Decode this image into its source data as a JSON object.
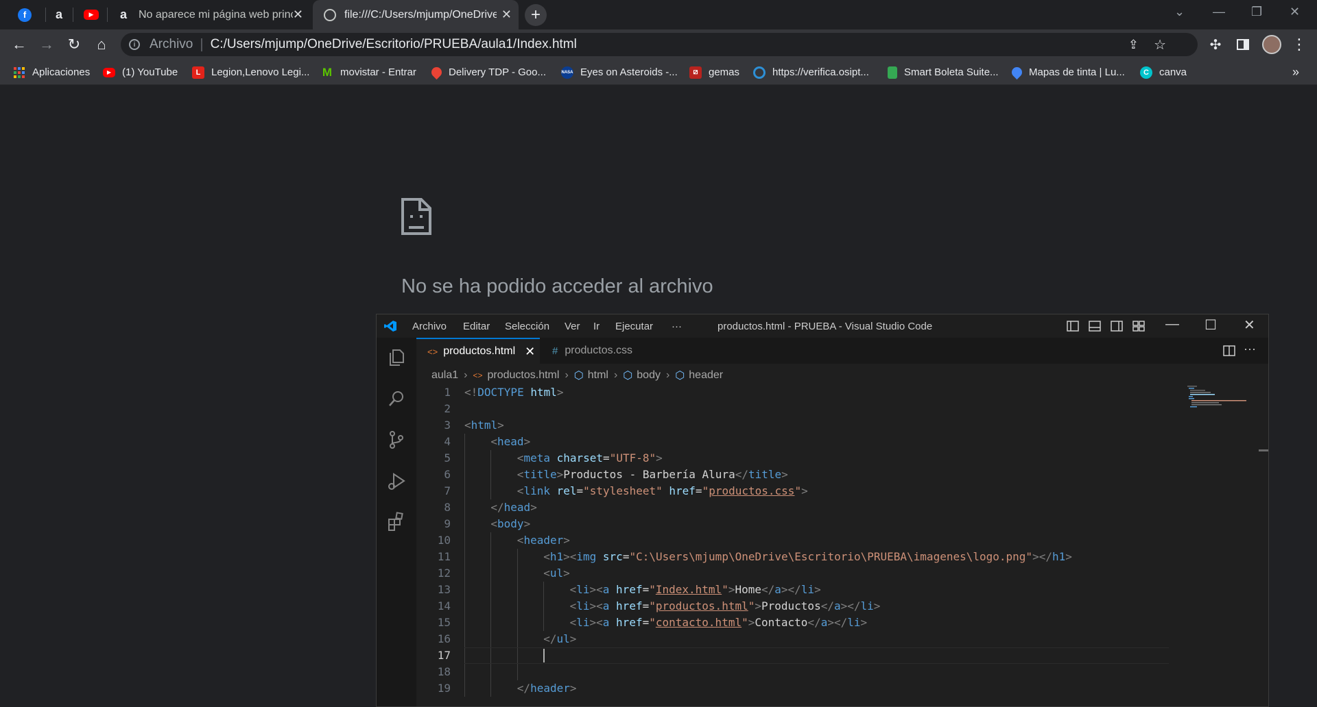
{
  "browser": {
    "tabs": [
      {
        "label": "",
        "icon": "facebook-icon"
      },
      {
        "label": "",
        "icon": "alura-icon"
      },
      {
        "label": "",
        "icon": "youtube-icon"
      },
      {
        "label": "No aparece mi página web princ",
        "icon": "alura-icon"
      },
      {
        "label": "file:///C:/Users/mjump/OneDrive",
        "icon": "globe-icon",
        "active": true
      }
    ],
    "address": {
      "scheme": "Archivo",
      "url": "C:/Users/mjump/OneDrive/Escritorio/PRUEBA/aula1/Index.html"
    },
    "bookmarks": [
      {
        "label": "Aplicaciones",
        "icon": "apps-grid-icon",
        "color": "#4285f4"
      },
      {
        "label": "(1) YouTube",
        "icon": "youtube-icon",
        "color": "#ff0000"
      },
      {
        "label": "Legion,Lenovo Legi...",
        "icon": "lenovo-icon",
        "color": "#e2231a"
      },
      {
        "label": "movistar - Entrar",
        "icon": "movistar-icon",
        "color": "#5bc500"
      },
      {
        "label": "Delivery TDP - Goo...",
        "icon": "maps-pin-icon",
        "color": "#ea4335"
      },
      {
        "label": "Eyes on Asteroids -...",
        "icon": "nasa-icon",
        "color": "#0b3d91"
      },
      {
        "label": "gemas",
        "icon": "dota-icon",
        "color": "#b8231e"
      },
      {
        "label": "https://verifica.osipt...",
        "icon": "osiptel-icon",
        "color": "#2d8fd5"
      },
      {
        "label": "Smart Boleta Suite...",
        "icon": "sheet-icon",
        "color": "#35a853"
      },
      {
        "label": "Mapas de tinta | Lu...",
        "icon": "location-icon",
        "color": "#4285f4"
      },
      {
        "label": "canva",
        "icon": "canva-icon",
        "color": "#00c4cc"
      }
    ],
    "more_bookmarks": "»"
  },
  "error_page": {
    "title": "No se ha podido acceder al archivo"
  },
  "vscode": {
    "menu": [
      "Archivo",
      "Editar",
      "Selección",
      "Ver",
      "Ir",
      "Ejecutar",
      "···"
    ],
    "window_title": "productos.html - PRUEBA - Visual Studio Code",
    "tabs": [
      {
        "label": "productos.html",
        "active": true,
        "icon": "<>"
      },
      {
        "label": "productos.css",
        "active": false,
        "icon": "#"
      }
    ],
    "breadcrumb": [
      "aula1",
      "productos.html",
      "html",
      "body",
      "header"
    ],
    "current_line": 17,
    "code_lines": [
      {
        "n": "1",
        "indent": 0,
        "tokens": [
          [
            "p",
            "<!"
          ],
          [
            "t",
            "DOCTYPE"
          ],
          [
            "w",
            " "
          ],
          [
            "a",
            "html"
          ],
          [
            "p",
            ">"
          ]
        ]
      },
      {
        "n": "2",
        "indent": 0,
        "tokens": []
      },
      {
        "n": "3",
        "indent": 0,
        "tokens": [
          [
            "p",
            "<"
          ],
          [
            "t",
            "html"
          ],
          [
            "p",
            ">"
          ]
        ]
      },
      {
        "n": "4",
        "indent": 1,
        "tokens": [
          [
            "p",
            "<"
          ],
          [
            "t",
            "head"
          ],
          [
            "p",
            ">"
          ]
        ]
      },
      {
        "n": "5",
        "indent": 2,
        "tokens": [
          [
            "p",
            "<"
          ],
          [
            "t",
            "meta"
          ],
          [
            "w",
            " "
          ],
          [
            "a",
            "charset"
          ],
          [
            "w",
            "="
          ],
          [
            "s",
            "\"UTF-8\""
          ],
          [
            "p",
            ">"
          ]
        ]
      },
      {
        "n": "6",
        "indent": 2,
        "tokens": [
          [
            "p",
            "<"
          ],
          [
            "t",
            "title"
          ],
          [
            "p",
            ">"
          ],
          [
            "w",
            "Productos - Barbería Alura"
          ],
          [
            "p",
            "</"
          ],
          [
            "t",
            "title"
          ],
          [
            "p",
            ">"
          ]
        ]
      },
      {
        "n": "7",
        "indent": 2,
        "tokens": [
          [
            "p",
            "<"
          ],
          [
            "t",
            "link"
          ],
          [
            "w",
            " "
          ],
          [
            "a",
            "rel"
          ],
          [
            "w",
            "="
          ],
          [
            "s",
            "\"stylesheet\""
          ],
          [
            "w",
            " "
          ],
          [
            "a",
            "href"
          ],
          [
            "w",
            "="
          ],
          [
            "s",
            "\""
          ],
          [
            "u",
            "productos.css"
          ],
          [
            "s",
            "\""
          ],
          [
            "p",
            ">"
          ]
        ]
      },
      {
        "n": "8",
        "indent": 1,
        "tokens": [
          [
            "p",
            "</"
          ],
          [
            "t",
            "head"
          ],
          [
            "p",
            ">"
          ]
        ]
      },
      {
        "n": "9",
        "indent": 1,
        "tokens": [
          [
            "p",
            "<"
          ],
          [
            "t",
            "body"
          ],
          [
            "p",
            ">"
          ]
        ]
      },
      {
        "n": "10",
        "indent": 2,
        "tokens": [
          [
            "p",
            "<"
          ],
          [
            "t",
            "header"
          ],
          [
            "p",
            ">"
          ]
        ]
      },
      {
        "n": "11",
        "indent": 3,
        "tokens": [
          [
            "p",
            "<"
          ],
          [
            "t",
            "h1"
          ],
          [
            "p",
            "><"
          ],
          [
            "t",
            "img"
          ],
          [
            "w",
            " "
          ],
          [
            "a",
            "src"
          ],
          [
            "w",
            "="
          ],
          [
            "s",
            "\"C:\\Users\\mjump\\OneDrive\\Escritorio\\PRUEBA\\imagenes\\logo.png\""
          ],
          [
            "p",
            "></"
          ],
          [
            "t",
            "h1"
          ],
          [
            "p",
            ">"
          ]
        ]
      },
      {
        "n": "12",
        "indent": 3,
        "tokens": [
          [
            "p",
            "<"
          ],
          [
            "t",
            "ul"
          ],
          [
            "p",
            ">"
          ]
        ]
      },
      {
        "n": "13",
        "indent": 4,
        "tokens": [
          [
            "p",
            "<"
          ],
          [
            "t",
            "li"
          ],
          [
            "p",
            "><"
          ],
          [
            "t",
            "a"
          ],
          [
            "w",
            " "
          ],
          [
            "a",
            "href"
          ],
          [
            "w",
            "="
          ],
          [
            "s",
            "\""
          ],
          [
            "u",
            "Index.html"
          ],
          [
            "s",
            "\""
          ],
          [
            "p",
            ">"
          ],
          [
            "w",
            "Home"
          ],
          [
            "p",
            "</"
          ],
          [
            "t",
            "a"
          ],
          [
            "p",
            "></"
          ],
          [
            "t",
            "li"
          ],
          [
            "p",
            ">"
          ]
        ]
      },
      {
        "n": "14",
        "indent": 4,
        "tokens": [
          [
            "p",
            "<"
          ],
          [
            "t",
            "li"
          ],
          [
            "p",
            "><"
          ],
          [
            "t",
            "a"
          ],
          [
            "w",
            " "
          ],
          [
            "a",
            "href"
          ],
          [
            "w",
            "="
          ],
          [
            "s",
            "\""
          ],
          [
            "u",
            "productos.html"
          ],
          [
            "s",
            "\""
          ],
          [
            "p",
            ">"
          ],
          [
            "w",
            "Productos"
          ],
          [
            "p",
            "</"
          ],
          [
            "t",
            "a"
          ],
          [
            "p",
            "></"
          ],
          [
            "t",
            "li"
          ],
          [
            "p",
            ">"
          ]
        ]
      },
      {
        "n": "15",
        "indent": 4,
        "tokens": [
          [
            "p",
            "<"
          ],
          [
            "t",
            "li"
          ],
          [
            "p",
            "><"
          ],
          [
            "t",
            "a"
          ],
          [
            "w",
            " "
          ],
          [
            "a",
            "href"
          ],
          [
            "w",
            "="
          ],
          [
            "s",
            "\""
          ],
          [
            "u",
            "contacto.html"
          ],
          [
            "s",
            "\""
          ],
          [
            "p",
            ">"
          ],
          [
            "w",
            "Contacto"
          ],
          [
            "p",
            "</"
          ],
          [
            "t",
            "a"
          ],
          [
            "p",
            "></"
          ],
          [
            "t",
            "li"
          ],
          [
            "p",
            ">"
          ]
        ]
      },
      {
        "n": "16",
        "indent": 3,
        "tokens": [
          [
            "p",
            "</"
          ],
          [
            "t",
            "ul"
          ],
          [
            "p",
            ">"
          ]
        ]
      },
      {
        "n": "17",
        "indent": 3,
        "tokens": []
      },
      {
        "n": "18",
        "indent": 0,
        "tokens": []
      },
      {
        "n": "19",
        "indent": 2,
        "tokens": [
          [
            "p",
            "</"
          ],
          [
            "t",
            "header"
          ],
          [
            "p",
            ">"
          ]
        ]
      }
    ]
  }
}
